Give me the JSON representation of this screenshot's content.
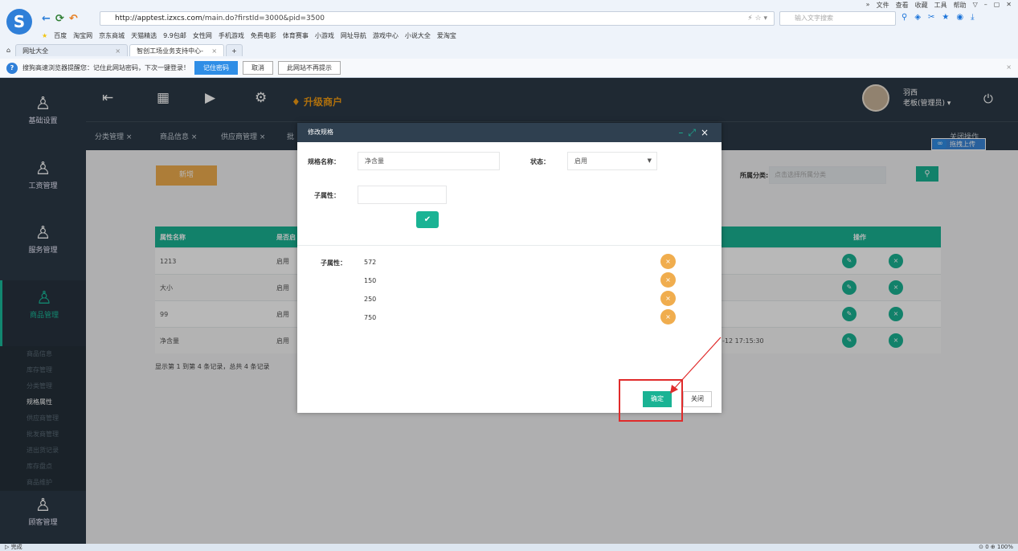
{
  "browser": {
    "top_menu": [
      "»",
      "文件",
      "查看",
      "收藏",
      "工具",
      "帮助",
      "▽",
      "–",
      "▢",
      "✕"
    ],
    "url_host": "http://apptest.izxcs.com",
    "url_path": "/main.do?firstId=3000&pid=3500",
    "search_placeholder": "输入文字搜索",
    "bookmarks": [
      "百度",
      "淘宝网",
      "京东商城",
      "天猫精选",
      "9.9包邮",
      "女性网",
      "手机游戏",
      "免费电影",
      "体育赛事",
      "小游戏",
      "网址导航",
      "游戏中心",
      "小说大全",
      "爱淘宝"
    ],
    "tabs": [
      {
        "label": "网址大全",
        "active": false
      },
      {
        "label": "智创工场业务支持中心-",
        "active": true
      }
    ],
    "notify_text": "搜狗高速浏览器提醒您：记住此网站密码，下次一键登录！",
    "notify_btn_save": "记住密码",
    "notify_btn_cancel": "取消",
    "notify_btn_never": "此网站不再提示",
    "status_left": "完成",
    "status_right": "⊙ 0   ⊕ 100%"
  },
  "sidebar": {
    "groups": [
      {
        "label": "基础设置",
        "active": false
      },
      {
        "label": "工资管理",
        "active": false
      },
      {
        "label": "服务管理",
        "active": false
      },
      {
        "label": "商品管理",
        "active": true
      },
      {
        "label": "顾客管理",
        "active": false
      }
    ],
    "submenu": [
      {
        "label": "商品信息",
        "active": false
      },
      {
        "label": "库存管理",
        "active": false
      },
      {
        "label": "分类管理",
        "active": false
      },
      {
        "label": "规格属性",
        "active": true
      },
      {
        "label": "供应商管理",
        "active": false
      },
      {
        "label": "批发商管理",
        "active": false
      },
      {
        "label": "进出货记录",
        "active": false
      },
      {
        "label": "库存盘点",
        "active": false
      },
      {
        "label": "商品维护",
        "active": false
      }
    ]
  },
  "topbar": {
    "upgrade_label": "升级商户",
    "user_name": "羽西",
    "user_role": "老板(管理员) ▾"
  },
  "page_tabs": [
    "分类管理 ×",
    "商品信息 ×",
    "供应商管理 ×",
    "批"
  ],
  "close_ops": "关闭操作",
  "upload_label": "拖拽上传",
  "main": {
    "add_button": "新增",
    "category_label": "所属分类:",
    "category_placeholder": "点击选择所属分类",
    "columns": [
      "属性名称",
      "是否启",
      "操作"
    ],
    "rows": [
      {
        "name": "1213",
        "status": "启用",
        "time": ""
      },
      {
        "name": "大小",
        "status": "启用",
        "time": ""
      },
      {
        "name": "99",
        "status": "启用",
        "time": ""
      },
      {
        "name": "净含量",
        "status": "启用",
        "time": "-12 17:15:30"
      }
    ],
    "record_info": "显示第 1 到第 4 条记录，总共 4 条记录"
  },
  "modal": {
    "title": "修改规格",
    "spec_name_label": "规格名称：",
    "spec_name_value": "净含量",
    "status_label": "状态：",
    "status_value": "启用",
    "sub_attr_label": "子属性：",
    "sub_attr_input_value": "",
    "sub_list_label": "子属性：",
    "sub_values": [
      "572",
      "150",
      "250",
      "750"
    ],
    "confirm_label": "确定",
    "close_label": "关闭"
  },
  "colors": {
    "accent": "#1ab394",
    "sidebar": "#2c3a47",
    "warning": "#f0ad4e",
    "annotation": "#e02b2b"
  }
}
